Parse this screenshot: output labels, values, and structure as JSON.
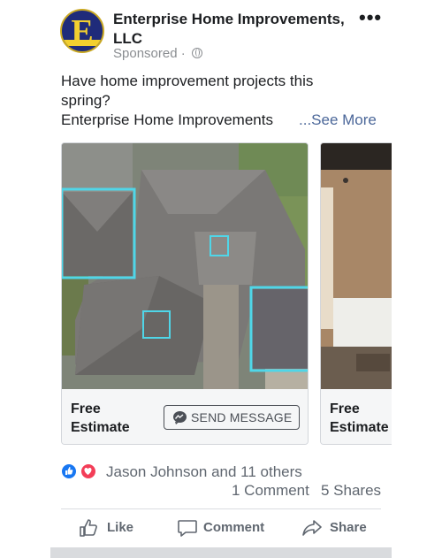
{
  "post": {
    "page_name": "Enterprise Home Improvements, LLC",
    "sponsored": "Sponsored · ",
    "logo_letter": "E",
    "text_line1": "Have home improvement projects this",
    "text_line2": "spring?",
    "text_line3": "Enterprise Home Improvements",
    "see_more": "...See More",
    "more_icon": "•••"
  },
  "carousel": {
    "cards": [
      {
        "title": "Free Estimate",
        "button_label": "SEND MESSAGE",
        "image": "aerial-roof-photo"
      },
      {
        "title": "Free Estimate",
        "image": "bathroom-photo"
      }
    ]
  },
  "engagement": {
    "reactions_text": "Jason Johnson and 11 others",
    "comments": "1 Comment",
    "shares": "5 Shares"
  },
  "actions": {
    "like": "Like",
    "comment": "Comment",
    "share": "Share"
  },
  "colors": {
    "link": "#4b6799",
    "like_blue": "#1877f2",
    "love_red": "#f33e58",
    "highlight_box": "#4fd6e8"
  }
}
